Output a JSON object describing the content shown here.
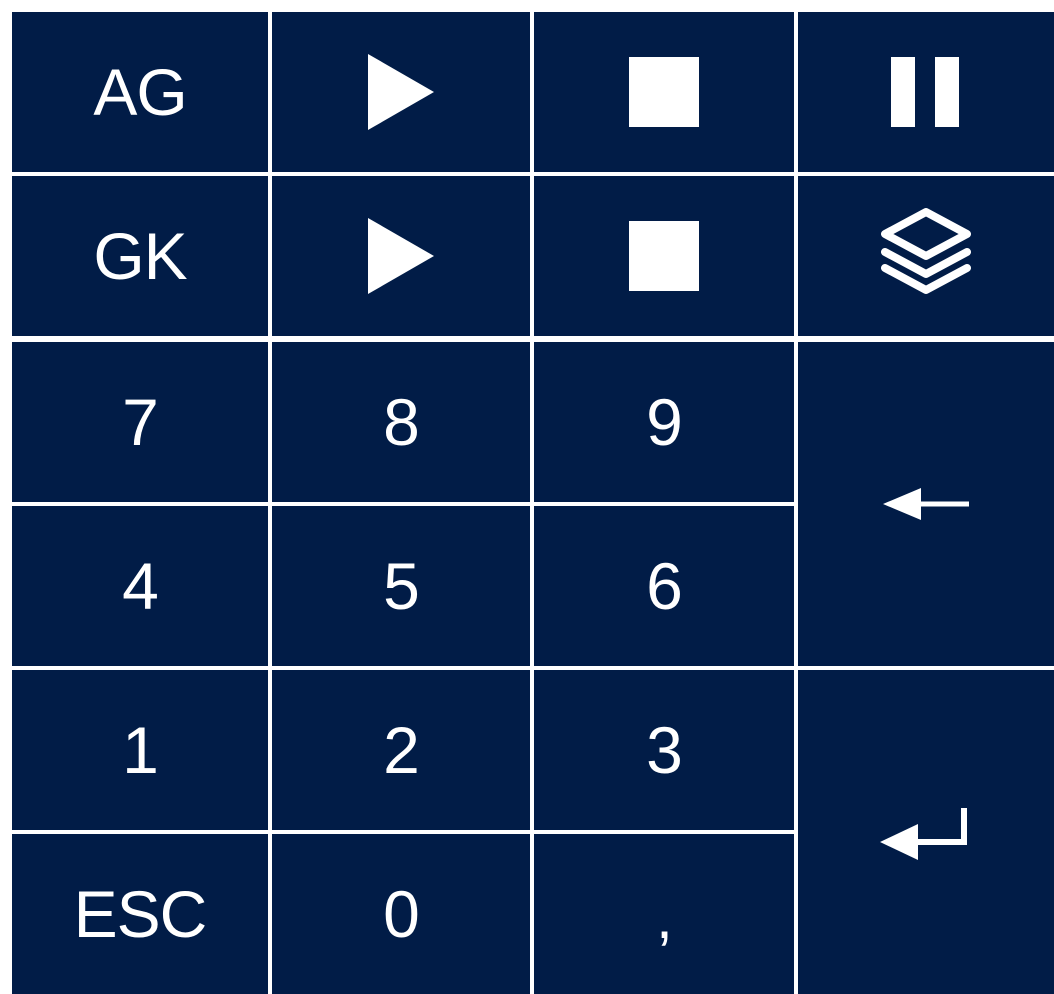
{
  "keypad": {
    "colors": {
      "key_background": "#011c47",
      "glyph": "#ffffff",
      "gridline": "#ffffff"
    },
    "rows": {
      "ag": {
        "label": "AG",
        "play_icon": "play-icon",
        "stop_icon": "stop-icon",
        "pause_icon": "pause-icon"
      },
      "gk": {
        "label": "GK",
        "play_icon": "play-icon",
        "stop_icon": "stop-icon",
        "layers_icon": "layers-icon"
      }
    },
    "digits": {
      "seven": "7",
      "eight": "8",
      "nine": "9",
      "four": "4",
      "five": "5",
      "six": "6",
      "one": "1",
      "two": "2",
      "three": "3",
      "zero": "0"
    },
    "esc_label": "ESC",
    "comma_label": ",",
    "backspace_icon": "arrow-left-icon",
    "enter_icon": "enter-return-icon"
  }
}
